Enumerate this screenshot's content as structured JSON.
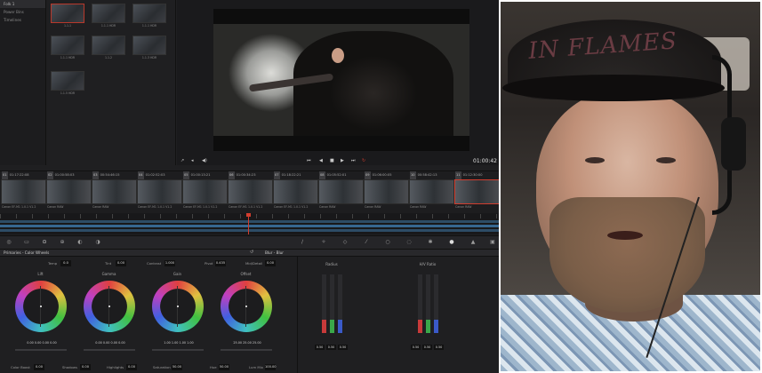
{
  "media_pool": {
    "sidebar": [
      "Folk 1",
      "Power Bins",
      "Timelines"
    ],
    "clips": [
      {
        "label": "1.1.1",
        "selected": true
      },
      {
        "label": "1.1.1 HDR"
      },
      {
        "label": "1.1.1 HDR"
      },
      {
        "label": "1.1.1 HDR"
      },
      {
        "label": "1.1.2"
      },
      {
        "label": "1.1.3 HDR"
      },
      {
        "label": "1.1.5 HDR"
      }
    ]
  },
  "viewer": {
    "timecode": "01:00:42"
  },
  "timeline_clips": [
    {
      "num": "01",
      "tc": "01:17:22:08",
      "name": "Canon EF-M1 1.0.1 V1.2"
    },
    {
      "num": "02",
      "tc": "01:00:58:03",
      "name": "Canon RAW"
    },
    {
      "num": "03",
      "tc": "00:54:46:15",
      "name": "Canon RAW"
    },
    {
      "num": "04",
      "tc": "01:02:52:03",
      "name": "Canon EF-M1 1.0.1 V1.2"
    },
    {
      "num": "05",
      "tc": "01:00:13:21",
      "name": "Canon EF-M1 1.0.1 V1.2"
    },
    {
      "num": "06",
      "tc": "01:00:34:23",
      "name": "Canon EF-M1 1.0.1 V1.2"
    },
    {
      "num": "07",
      "tc": "01:18:22:21",
      "name": "Canon EF-M1 1.0.1 V1.2"
    },
    {
      "num": "08",
      "tc": "01:05:52:01",
      "name": "Canon RAW"
    },
    {
      "num": "09",
      "tc": "01:06:00:05",
      "name": "Canon RAW"
    },
    {
      "num": "10",
      "tc": "00:58:42:13",
      "name": "Canon RAW"
    },
    {
      "num": "11",
      "tc": "01:12:30:00",
      "name": "Canon RAW",
      "selected": true
    }
  ],
  "panel": {
    "left_title": "Primaries - Color Wheels",
    "right_title": "Blur - Blur",
    "adjustments": [
      {
        "label": "Temp",
        "value": "0.0"
      },
      {
        "label": "Tint",
        "value": "0.00"
      },
      {
        "label": "Contrast",
        "value": "1.000"
      },
      {
        "label": "Pivot",
        "value": "0.435"
      },
      {
        "label": "Mid/Detail",
        "value": "0.00"
      }
    ],
    "wheels": [
      {
        "label": "Lift",
        "values": "0.00   0.00   0.00   0.00"
      },
      {
        "label": "Gamma",
        "values": "0.00   0.00   0.00   0.00"
      },
      {
        "label": "Gain",
        "values": "1.00   1.00   1.00   1.00"
      },
      {
        "label": "Offset",
        "values": "25.00   25.00   25.00"
      }
    ],
    "bottom": [
      {
        "label": "Color Boost",
        "value": "0.00"
      },
      {
        "label": "Shadows",
        "value": "0.00"
      },
      {
        "label": "Highlights",
        "value": "0.00"
      },
      {
        "label": "Saturation",
        "value": "50.00"
      },
      {
        "label": "Hue",
        "value": "50.00"
      },
      {
        "label": "Lum Mix",
        "value": "100.00"
      }
    ],
    "blur_groups": [
      {
        "label": "Radius",
        "bars": [
          0.22,
          0.22,
          0.22
        ],
        "values": [
          "0.50",
          "0.50",
          "0.50"
        ]
      },
      {
        "label": "H/V Ratio",
        "bars": [
          0.22,
          0.22,
          0.22
        ],
        "values": [
          "0.50",
          "0.50",
          "0.50"
        ]
      }
    ]
  },
  "colors": {
    "accent": "#d13d2e",
    "red": "#c83a3a",
    "green": "#3aa84a",
    "blue": "#3a5ac8"
  },
  "webcam": {
    "cap_text": "IN FLAMES"
  }
}
